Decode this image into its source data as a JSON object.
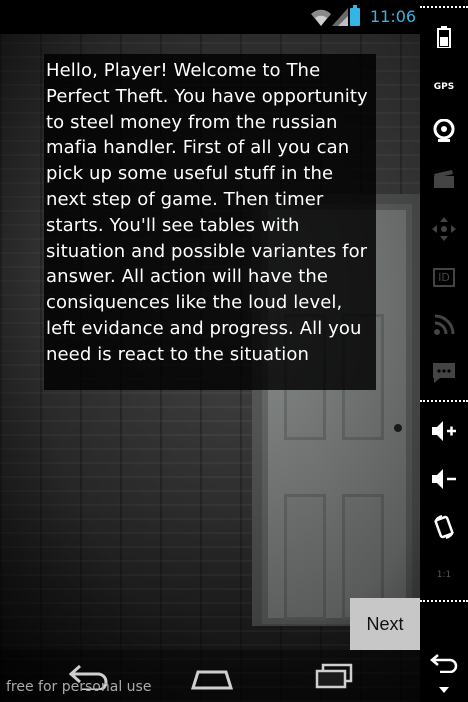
{
  "status_bar": {
    "time": "11:06"
  },
  "intro": {
    "text": "Hello, Player! Welcome to The Perfect Theft. You have opportunity to steel money from the russian mafia handler. First of all you can pick up some useful stuff in the next step of game. Then timer starts. You'll see tables with situation and possible variantes for answer. All action will have the consiquences like the loud level, left evidance and progress. All you need is react to the situation"
  },
  "buttons": {
    "next_label": "Next"
  },
  "watermark": "free for personal use",
  "side_panel": {
    "gps_label": "GPS",
    "id_label": "ID",
    "scale_label": "1:1"
  },
  "colors": {
    "status_accent": "#33b5e5",
    "button_bg": "#c7c7c7",
    "text_panel_bg": "#000000"
  },
  "icons": {
    "status": [
      "wifi-icon",
      "signal-icon",
      "battery-icon"
    ],
    "nav": [
      "back-icon",
      "home-icon",
      "recents-icon"
    ],
    "side": [
      "battery-icon",
      "gps-icon",
      "webcam-icon",
      "clapper-icon",
      "dpad-icon",
      "id-icon",
      "rss-icon",
      "sms-icon",
      "volume-up-icon",
      "volume-down-icon",
      "rotate-icon",
      "scale-icon",
      "back-icon"
    ]
  }
}
